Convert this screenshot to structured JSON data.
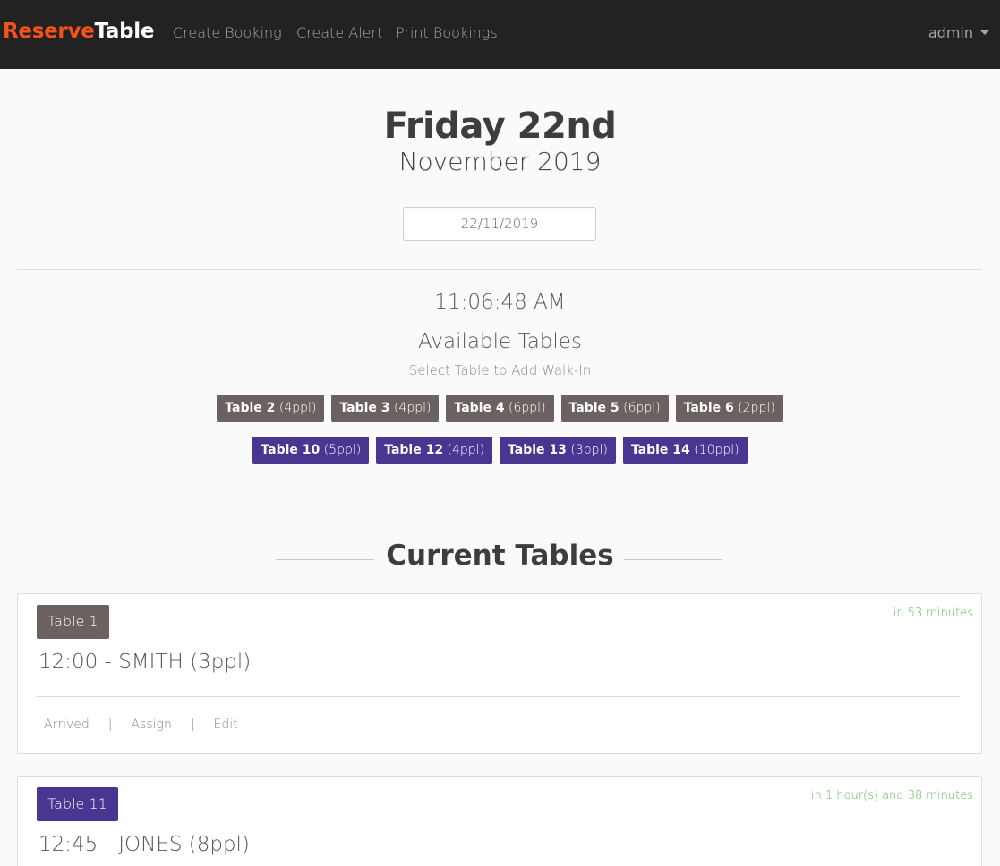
{
  "navbar": {
    "brand_part1": "Reserve",
    "brand_part2": "Table",
    "links": [
      "Create Booking",
      "Create Alert",
      "Print Bookings"
    ],
    "user": "admin"
  },
  "header": {
    "day": "Friday 22nd",
    "month_year": "November 2019",
    "date_value": "22/11/2019"
  },
  "clock": "11:06:48 AM",
  "available": {
    "title": "Available Tables",
    "subtitle": "Select Table to Add Walk-In",
    "row1": [
      {
        "name": "Table 2",
        "cap": "(4ppl)"
      },
      {
        "name": "Table 3",
        "cap": "(4ppl)"
      },
      {
        "name": "Table 4",
        "cap": "(6ppl)"
      },
      {
        "name": "Table 5",
        "cap": "(6ppl)"
      },
      {
        "name": "Table 6",
        "cap": "(2ppl)"
      }
    ],
    "row2": [
      {
        "name": "Table 10",
        "cap": "(5ppl)"
      },
      {
        "name": "Table 12",
        "cap": "(4ppl)"
      },
      {
        "name": "Table 13",
        "cap": "(3ppl)"
      },
      {
        "name": "Table 14",
        "cap": "(10ppl)"
      }
    ]
  },
  "current": {
    "heading": "Current Tables",
    "cards": [
      {
        "table": "Table 1",
        "eta": "in 53 minutes",
        "booking": "12:00 - SMITH (3ppl)",
        "actions": [
          "Arrived",
          "Assign",
          "Edit"
        ]
      },
      {
        "table": "Table 11",
        "eta": "in 1 hour(s) and 38 minutes",
        "booking": "12:45 - JONES (8ppl)"
      }
    ]
  },
  "colors": {
    "navbar_bg": "#222222",
    "brand_accent": "#f2531a",
    "table_grey": "#6b6161",
    "table_purple": "#4a3590",
    "eta_green": "#5cb85c"
  }
}
